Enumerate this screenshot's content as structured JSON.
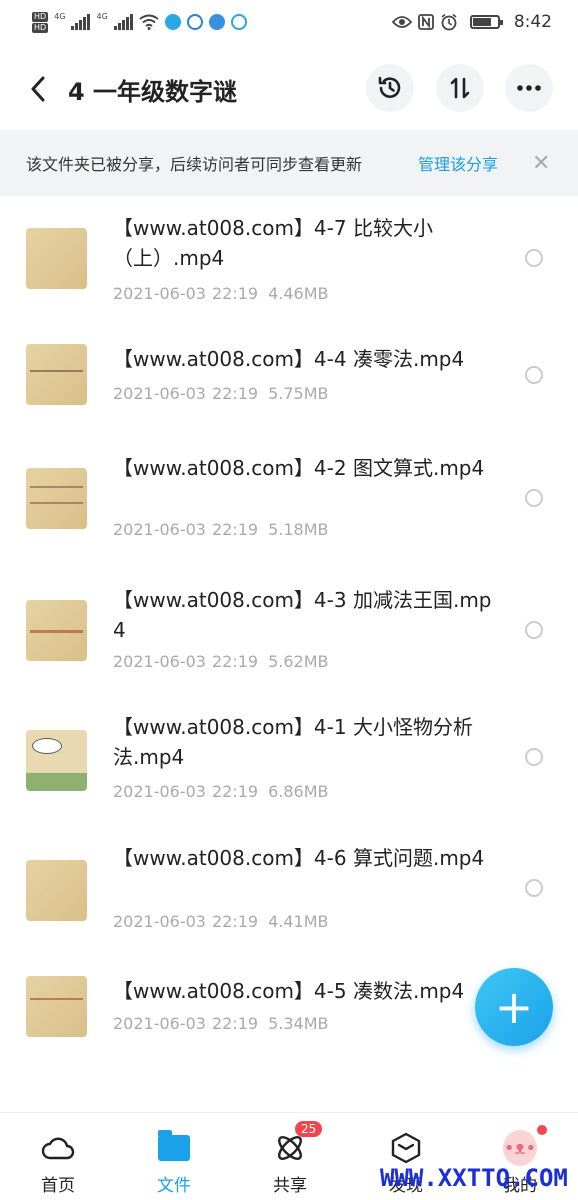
{
  "status_bar": {
    "time": "8:42",
    "hd_label_1": "HD",
    "hd_label_2": "HD",
    "signal_1_label": "4G",
    "signal_2_label": "4G",
    "icons": [
      "wifi-icon",
      "app-icon-1",
      "app-icon-2",
      "app-icon-3",
      "app-icon-4",
      "eye-icon",
      "nfc-icon",
      "alarm-icon",
      "battery-icon"
    ]
  },
  "header": {
    "back_icon": "‹",
    "title": "4 一年级数字谜",
    "history_icon": "history-icon",
    "sort_icon": "sort-icon",
    "more_icon": "more-icon"
  },
  "banner": {
    "text": "该文件夹已被分享，后续访问者可同步查看更新",
    "manage_link": "管理该分享",
    "close_glyph": "✕"
  },
  "files": [
    {
      "name": "【www.at008.com】4-7 比较大小（上）.mp4",
      "date": "2021-06-03",
      "time": "22:19",
      "size": "4.46MB",
      "thumb": "paper"
    },
    {
      "name": "【www.at008.com】4-4 凑零法.mp4",
      "date": "2021-06-03",
      "time": "22:19",
      "size": "5.75MB",
      "thumb": "paper"
    },
    {
      "name": "【www.at008.com】4-2 图文算式.mp4",
      "date": "2021-06-03",
      "time": "22:19",
      "size": "5.18MB",
      "thumb": "paper"
    },
    {
      "name": "【www.at008.com】4-3 加减法王国.mp4",
      "date": "2021-06-03",
      "time": "22:19",
      "size": "5.62MB",
      "thumb": "paper"
    },
    {
      "name": "【www.at008.com】4-1 大小怪物分析法.mp4",
      "date": "2021-06-03",
      "time": "22:19",
      "size": "6.86MB",
      "thumb": "cartoon"
    },
    {
      "name": "【www.at008.com】4-6 算式问题.mp4",
      "date": "2021-06-03",
      "time": "22:19",
      "size": "4.41MB",
      "thumb": "paper"
    },
    {
      "name": "【www.at008.com】4-5 凑数法.mp4",
      "date": "2021-06-03",
      "time": "22:19",
      "size": "5.34MB",
      "thumb": "paper"
    }
  ],
  "fab": {
    "glyph": "+"
  },
  "nav": {
    "items": [
      {
        "label": "首页",
        "icon": "cloud-icon",
        "active": false
      },
      {
        "label": "文件",
        "icon": "folder-icon",
        "active": true
      },
      {
        "label": "共享",
        "icon": "share-orbit-icon",
        "active": false,
        "badge": "25"
      },
      {
        "label": "发现",
        "icon": "cube-icon",
        "active": false
      },
      {
        "label": "我的",
        "icon": "avatar-icon",
        "active": false
      }
    ]
  },
  "watermark": "WWW.XXTTQ.COM",
  "colors": {
    "accent": "#1aa1ea",
    "link": "#1a9ee6",
    "badge": "#f0464e",
    "banner_bg": "#f2f3f5",
    "meta_text": "#aaaaaa",
    "watermark": "#1b2ed9"
  }
}
